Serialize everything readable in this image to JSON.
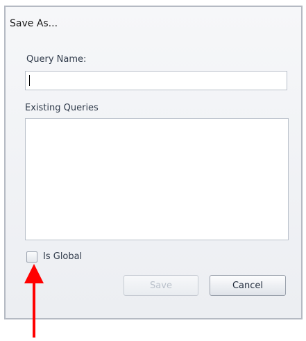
{
  "dialog": {
    "title": "Save As...",
    "query_name_label": "Query Name:",
    "query_name_value": "",
    "existing_queries_label": "Existing Queries",
    "existing_queries": [],
    "is_global_label": "Is Global",
    "is_global_checked": false,
    "save_label": "Save",
    "save_enabled": false,
    "cancel_label": "Cancel"
  },
  "annotation": {
    "arrow_color": "#ff0000",
    "points_to": "is-global-checkbox"
  }
}
